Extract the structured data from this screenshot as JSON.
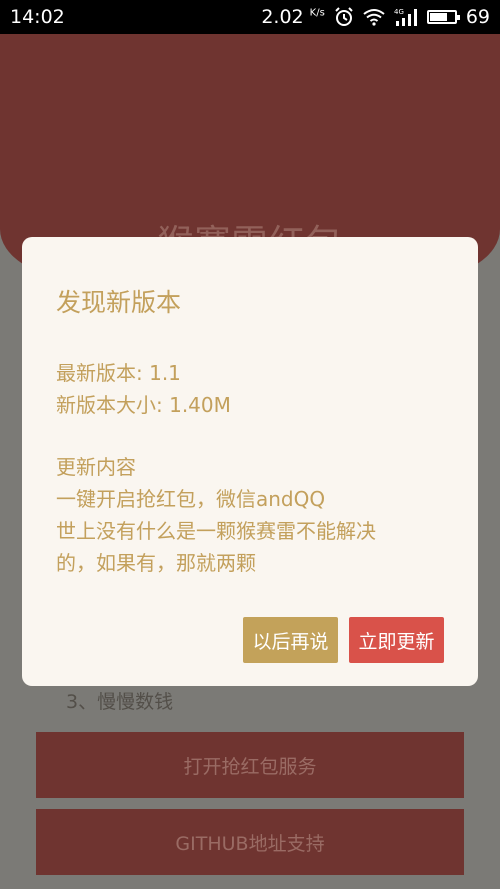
{
  "status_bar": {
    "time": "14:02",
    "net_speed": "2.02",
    "net_unit": "K/s",
    "network_label": "4G",
    "battery": "69",
    "battery_level": 0.69
  },
  "header": {
    "title": "猴赛雷红包"
  },
  "background": {
    "step_text": "3、慢慢数钱",
    "open_service_button": "打开抢红包服务",
    "github_button": "GITHUB地址支持"
  },
  "dialog": {
    "title": "发现新版本",
    "latest_version": "最新版本: 1.1",
    "package_size": "新版本大小: 1.40M",
    "changelog_heading": "更新内容",
    "changelog_line1": "一键开启抢红包，微信andQQ",
    "changelog_line2": "世上没有什么是一颗猴赛雷不能解决",
    "changelog_line3": "的，如果有，那就两颗",
    "later_button": "以后再说",
    "update_button": "立即更新"
  }
}
